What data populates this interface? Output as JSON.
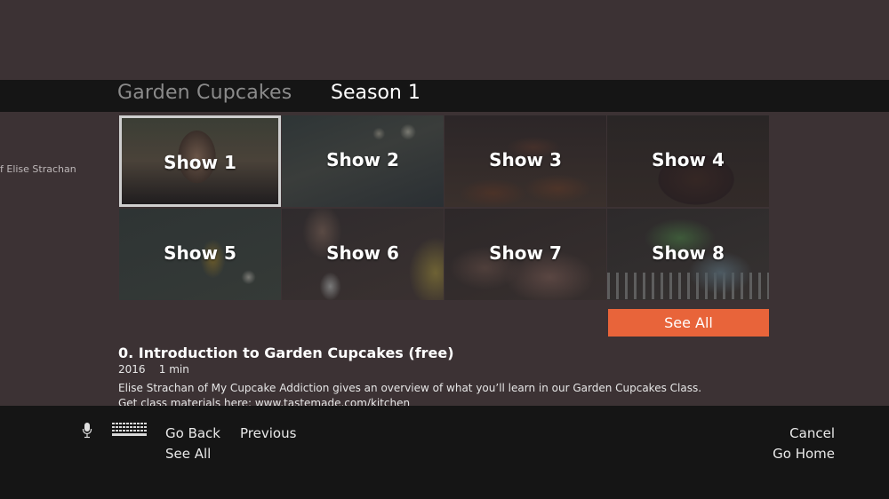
{
  "header": {
    "show_title": "Garden Cupcakes",
    "season": "Season 1"
  },
  "side_panel": {
    "text": "f Elise Strachan"
  },
  "shows": [
    {
      "label": "Show 1"
    },
    {
      "label": "Show 2"
    },
    {
      "label": "Show 3"
    },
    {
      "label": "Show 4"
    },
    {
      "label": "Show 5"
    },
    {
      "label": "Show 6"
    },
    {
      "label": "Show 7"
    },
    {
      "label": "Show 8"
    }
  ],
  "see_all_button": "See All",
  "episode": {
    "title": "0. Introduction to Garden Cupcakes (free)",
    "meta": "2016    1 min",
    "description_line1": "Elise Strachan of My Cupcake Addiction gives an overview of what you’ll learn in our Garden Cupcakes Class.",
    "description_line2": "Get class materials here: www.tastemade.com/kitchen"
  },
  "footer": {
    "go_back": "Go Back",
    "previous": "Previous",
    "see_all": "See All",
    "cancel": "Cancel",
    "go_home": "Go Home",
    "icons": [
      "microphone-icon",
      "keyboard-icon"
    ]
  },
  "colors": {
    "background": "#3c3234",
    "bar": "#151515",
    "accent": "#e8643a"
  }
}
